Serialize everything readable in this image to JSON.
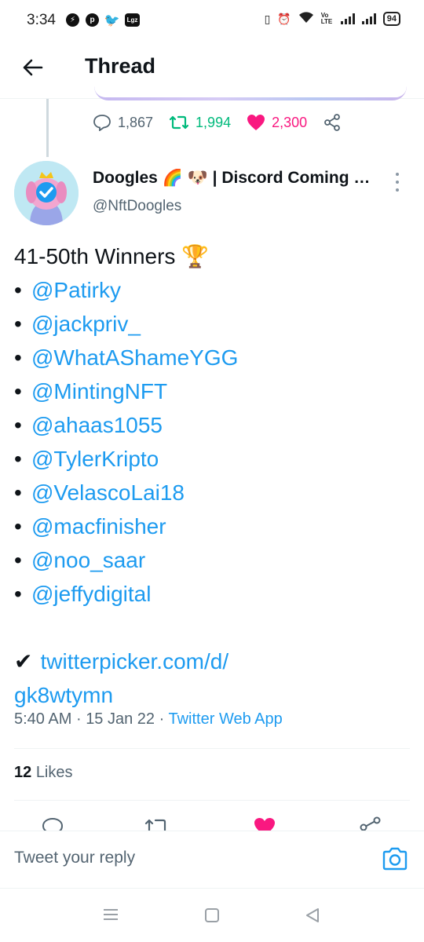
{
  "status_bar": {
    "time": "3:34",
    "left_icons": [
      "messenger-icon",
      "pinterest-icon",
      "twitter-icon",
      "app-icon"
    ],
    "app_icon_label": "Lgz",
    "right_icons": [
      "vibrate-icon",
      "alarm-icon",
      "wifi-icon",
      "volte-icon",
      "signal-icon",
      "signal-icon"
    ],
    "volte_label": "Vo LTE",
    "battery": "94"
  },
  "header": {
    "title": "Thread"
  },
  "previous_tweet": {
    "replies": "1,867",
    "retweets": "1,994",
    "likes": "2,300"
  },
  "tweet": {
    "author_name": "Doogles 🌈 🐶 | Discord Coming …",
    "author_handle": "@NftDoogles",
    "heading": "41-50th Winners 🏆",
    "winners": [
      "@Patirky",
      "@jackpriv_",
      "@WhatAShameYGG",
      "@MintingNFT",
      "@ahaas1055",
      "@TylerKripto",
      "@VelascoLai18",
      "@macfinisher",
      "@noo_saar",
      "@jeffydigital"
    ],
    "bullet": "•",
    "check_mark": "✔",
    "link_line1": "twitterpicker.com/d/",
    "link_line2": "gk8wtymn",
    "time": "5:40 AM",
    "separator": "·",
    "date": "15 Jan 22",
    "source": "Twitter Web App",
    "likes_count": "12",
    "likes_label": "Likes"
  },
  "reply": {
    "placeholder": "Tweet your reply"
  },
  "colors": {
    "accent": "#1d9bf0",
    "retweet": "#00ba7c",
    "like": "#f91880",
    "secondary_text": "#536471"
  }
}
